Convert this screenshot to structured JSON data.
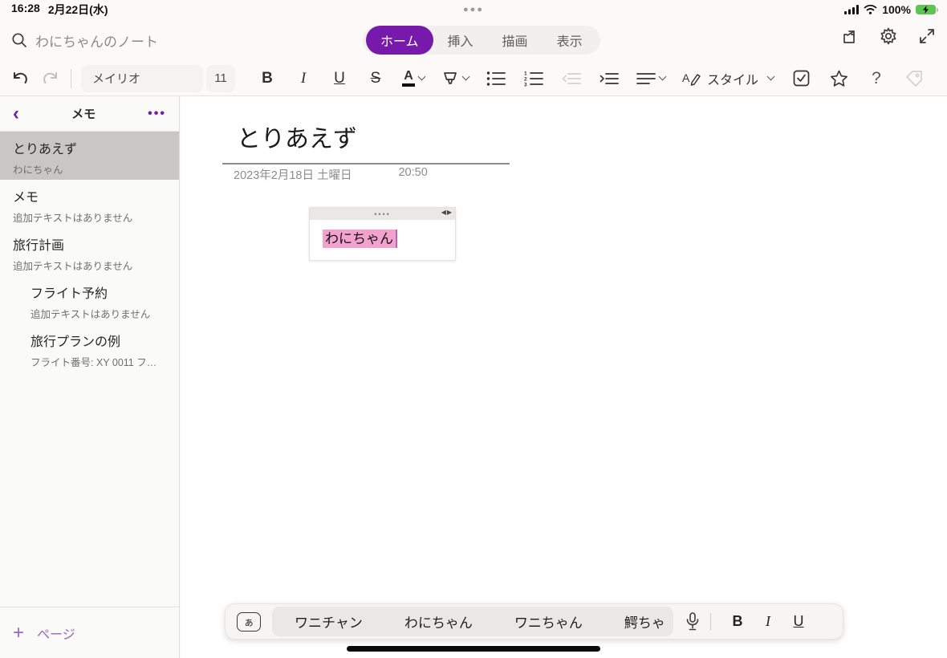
{
  "status_bar": {
    "time": "16:28",
    "date": "2月22日(水)",
    "battery_percent": "100%",
    "multitask_dots": "●●●"
  },
  "header": {
    "search_placeholder": "わにちゃんのノート",
    "tabs": [
      {
        "label": "ホーム",
        "active": true
      },
      {
        "label": "挿入",
        "active": false
      },
      {
        "label": "描画",
        "active": false
      },
      {
        "label": "表示",
        "active": false
      }
    ]
  },
  "toolbar": {
    "font_name": "メイリオ",
    "font_size": "11",
    "bold": "B",
    "italic": "I",
    "underline": "U",
    "strikethrough": "S",
    "font_color_letter": "A",
    "style_label": "スタイル",
    "help_label": "?"
  },
  "sidebar": {
    "title": "メモ",
    "more_label": "•••",
    "items": [
      {
        "title": "とりあえず",
        "subtitle": "わにちゃん"
      },
      {
        "title": "メモ",
        "subtitle": "追加テキストはありません"
      },
      {
        "title": "旅行計画",
        "subtitle": "追加テキストはありません"
      },
      {
        "title": "フライト予約",
        "subtitle": "追加テキストはありません"
      },
      {
        "title": "旅行プランの例",
        "subtitle": "フライト番号: XY 0011  フ…"
      }
    ],
    "add_page_label": "ページ",
    "add_page_plus": "+"
  },
  "page": {
    "title": "とりあえず",
    "date": "2023年2月18日 土曜日",
    "time": "20:50",
    "note_text": "わにちゃん",
    "drag_dots": "••••",
    "resize_arrows": "◀▶",
    "highlight_color": "#f2a2cc"
  },
  "suggestion_bar": {
    "input_mode_key": "ぁ",
    "suggestions": [
      "ワニチャン",
      "わにちゃん",
      "ワニちゃん",
      "鰐ちゃ"
    ],
    "bold": "B",
    "italic": "I",
    "underline": "U"
  },
  "colors": {
    "accent": "#7719aa",
    "highlight_pink": "#f2a2cc",
    "battery_green": "#5fc455"
  }
}
